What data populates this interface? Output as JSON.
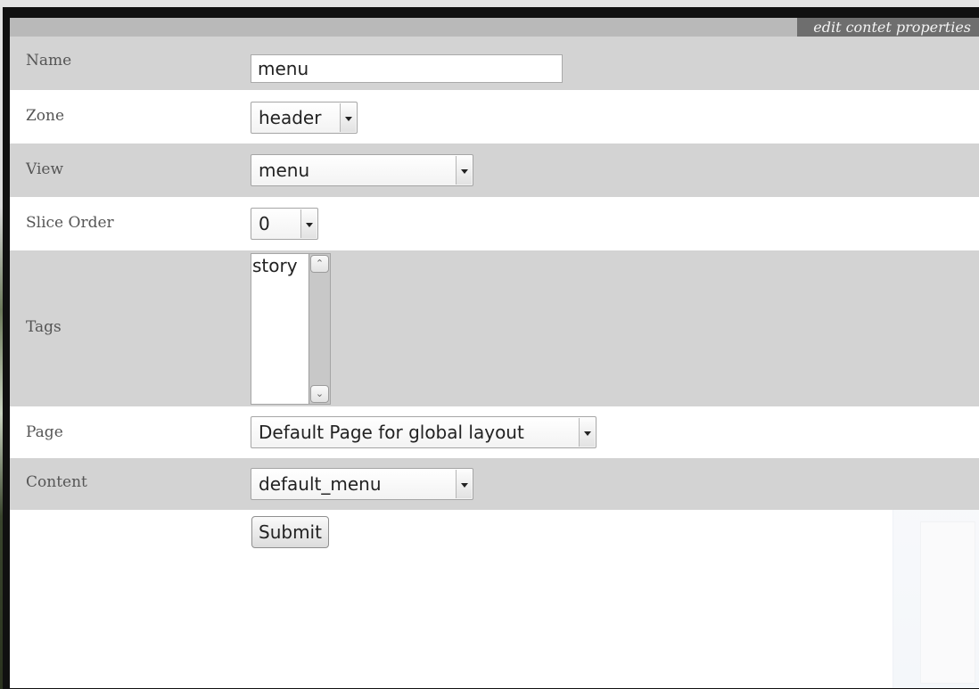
{
  "dialog": {
    "title": "edit contet properties"
  },
  "form": {
    "name": {
      "label": "Name",
      "value": "menu"
    },
    "zone": {
      "label": "Zone",
      "selected": "header"
    },
    "view": {
      "label": "View",
      "selected": "menu"
    },
    "slice_order": {
      "label": "Slice Order",
      "selected": "0"
    },
    "tags": {
      "label": "Tags",
      "options": [
        "story"
      ]
    },
    "page": {
      "label": "Page",
      "selected": "Default Page for global layout"
    },
    "content": {
      "label": "Content",
      "selected": "default_menu"
    },
    "submit_label": "Submit"
  },
  "colors": {
    "title_bar": "#b9b9b9",
    "title_tab": "#6e6e6e",
    "row_grey": "#d3d3d3",
    "row_white": "#ffffff",
    "frame": "#101010"
  },
  "icons": {
    "dropdown_arrow": "chevron-down-icon",
    "scroll_up": "scroll-up-arrow-icon",
    "scroll_down": "scroll-down-arrow-icon"
  }
}
